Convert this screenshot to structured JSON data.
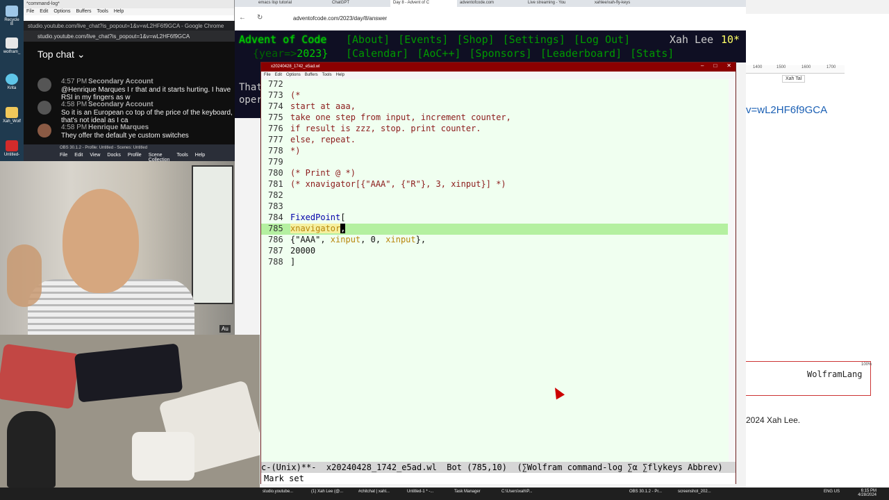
{
  "desktop": {
    "icons": [
      "Recycle B",
      "wolfram_",
      "Krita",
      "Xah_Wolf",
      "Untitled-"
    ]
  },
  "left_window": {
    "title": "*command-log*",
    "menu": [
      "File",
      "Edit",
      "Options",
      "Buffers",
      "Tools",
      "Help"
    ]
  },
  "chat": {
    "tab_url": "studio.youtube.com/live_chat?is_popout=1&v=wL2HF6f9GCA - Google Chrome",
    "url": "studio.youtube.com/live_chat?is_popout=1&v=wL2HF6f9GCA",
    "header": "Top chat",
    "messages": [
      {
        "time": "4:57 PM",
        "name": "Secondary Account",
        "text": "@Henrique Marques I r that and it starts hurting. I have RSI in my fingers as w"
      },
      {
        "time": "4:58 PM",
        "name": "Secondary Account",
        "text": "So it is an European co top of the price of the keyboard, that's not ideal as I ca"
      },
      {
        "time": "4:58 PM",
        "name": "Henrique Marques",
        "text": "They offer the default ye custom switches"
      }
    ]
  },
  "obs": {
    "title": "OBS 30.1.2 - Profile: Untitled - Scenes: Untitled",
    "menu": [
      "File",
      "Edit",
      "View",
      "Docks",
      "Profile",
      "Scene Collection",
      "Tools",
      "Help"
    ],
    "side_label": "Au"
  },
  "chrome": {
    "tabs": [
      "emacs lisp tutorial",
      "ChatGPT",
      "Day 8 - Advent of C",
      "adventofcode.com",
      "Live streaming - You",
      "xahlee/xah-fly-keys"
    ],
    "url": "adventofcode.com/2023/day/8/answer"
  },
  "aoc": {
    "title": "Advent of Code",
    "year_prefix": "{year=>",
    "year": "2023}",
    "links_row1": [
      "[About]",
      "[Events]",
      "[Shop]",
      "[Settings]",
      "[Log Out]"
    ],
    "links_row2": [
      "[Calendar]",
      "[AoC++]",
      "[Sponsors]",
      "[Leaderboard]",
      "[Stats]"
    ],
    "user": "Xah Lee",
    "stars": "10*",
    "body_lines": [
      "That",
      "oper"
    ]
  },
  "right_window": {
    "tab": "Xah Tal",
    "ruler": [
      "1400",
      "1500",
      "1600",
      "1700"
    ],
    "link_text": "v=wL2HF6f9GCA",
    "wolfram": "WolframLang",
    "zoom": "100%",
    "copyright": "2024 Xah Lee."
  },
  "emacs": {
    "title": "x20240428_1742_e5ad.wl",
    "menu": [
      "File",
      "Edit",
      "Options",
      "Buffers",
      "Tools",
      "Help"
    ],
    "lines": [
      {
        "n": "772",
        "text": ""
      },
      {
        "n": "773",
        "text": "(*"
      },
      {
        "n": "774",
        "text": "start at aaa,"
      },
      {
        "n": "775",
        "text": "take one step from input, increment counter,"
      },
      {
        "n": "776",
        "text": "if result is zzz, stop. print counter."
      },
      {
        "n": "777",
        "text": "else, repeat."
      },
      {
        "n": "778",
        "text": "*)"
      },
      {
        "n": "779",
        "text": ""
      },
      {
        "n": "780",
        "text": "(* Print @ *)"
      },
      {
        "n": "781",
        "text": "(* xnavigator[{\"AAA\", {\"R\"}, 3, xinput}] *)"
      },
      {
        "n": "782",
        "text": ""
      },
      {
        "n": "783",
        "text": ""
      },
      {
        "n": "784",
        "fn": "FixedPoint",
        "rest": "["
      },
      {
        "n": "785",
        "var": "xnavigator",
        "cursor": ","
      },
      {
        "n": "786",
        "p1": "{\"AAA\", ",
        "v1": "xinput",
        "p2": ", 0, ",
        "v2": "xinput",
        "p3": "},"
      },
      {
        "n": "787",
        "text": "20000"
      },
      {
        "n": "788",
        "text": "]"
      }
    ],
    "mode_line": "c-(Unix)**-  x20240428_1742_e5ad.wl  Bot (785,10)  (∑Wolfram command-log ∑α ∑flykeys Abbrev)",
    "echo": "Mark set"
  },
  "taskbar": {
    "items": [
      "studio.youtube...",
      "(1) Xah Lee (@...",
      "#chitchat | xahl...",
      "Untitled-1 * -...",
      "Task Manager",
      "C:\\Users\\xah\\P...",
      "OBS 30.1.2 - Pr...",
      "screenshot_202..."
    ],
    "lang": "ENG US",
    "time": "6:15 PM",
    "date": "4/28/2024"
  }
}
